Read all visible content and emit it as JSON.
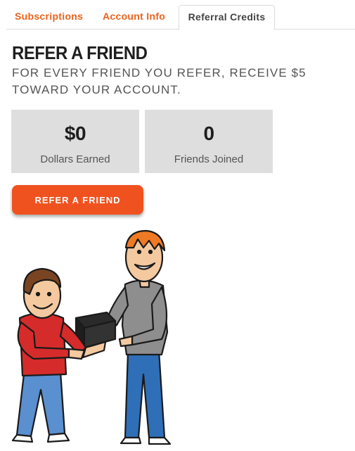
{
  "tabs": [
    {
      "label": "Subscriptions"
    },
    {
      "label": "Account Info"
    },
    {
      "label": "Referral Credits"
    }
  ],
  "active_tab": "Referral Credits",
  "main": {
    "title": "REFER A FRIEND",
    "subtitle": "FOR EVERY FRIEND YOU REFER, RECEIVE $5 TOWARD YOUR ACCOUNT.",
    "stats": [
      {
        "value": "$0",
        "label": "Dollars Earned"
      },
      {
        "value": "0",
        "label": "Friends Joined"
      }
    ],
    "refer_button_label": "REFER A FRIEND"
  },
  "colors": {
    "accent": "#f0521f",
    "tab_text": "#e8631c",
    "stat_bg": "#dedede"
  },
  "illustration": {
    "icon": "friends-gift-illustration"
  }
}
